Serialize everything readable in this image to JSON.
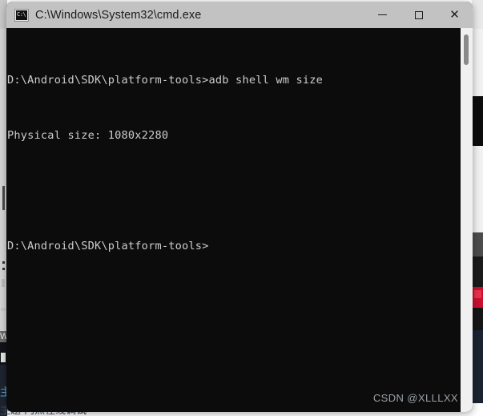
{
  "window": {
    "title": "C:\\Windows\\System32\\cmd.exe",
    "icon": "cmd-console-icon",
    "icon_label": "C:\\",
    "titlebar_color": "#c2c2c2",
    "controls": {
      "minimize_label": "—",
      "maximize_label": "□",
      "close_label": "✕"
    }
  },
  "console": {
    "background_color": "#0c0c0c",
    "text_color": "#cccccc",
    "lines": [
      "D:\\Android\\SDK\\platform-tools>adb shell wm size",
      "Physical size: 1080x2280",
      "",
      "D:\\Android\\SDK\\platform-tools>"
    ],
    "prompt_path": "D:\\Android\\SDK\\platform-tools>",
    "command": "adb shell wm size",
    "output": "Physical size: 1080x2280",
    "device_resolution": "1080x2280"
  },
  "watermark": {
    "text": "CSDN @XLLLXX"
  },
  "background": {
    "bottom_text": "主题  内点在线调试",
    "left_w_label": "W",
    "left_hash_label": "主"
  }
}
